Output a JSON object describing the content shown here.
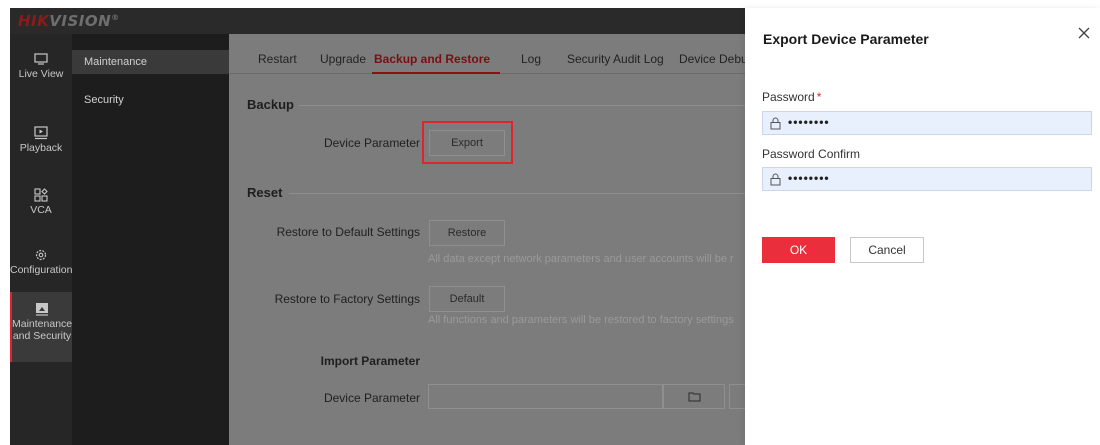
{
  "logo": {
    "brand": "HIK",
    "brand2": "VISION",
    "mark": "®"
  },
  "rail": {
    "items": [
      {
        "label": "Live View",
        "icon": "monitor-icon"
      },
      {
        "label": "Playback",
        "icon": "playback-icon"
      },
      {
        "label": "VCA",
        "icon": "vca-grid-icon"
      },
      {
        "label": "Configuration",
        "icon": "gear-icon"
      },
      {
        "label": "Maintenance and Security",
        "line1": "Maintenance",
        "line2": "and Security",
        "icon": "maintenance-icon",
        "active": true
      }
    ]
  },
  "submenu": {
    "items": [
      {
        "label": "Maintenance",
        "active": true
      },
      {
        "label": "Security"
      }
    ]
  },
  "tabs": {
    "items": [
      {
        "label": "Restart"
      },
      {
        "label": "Upgrade"
      },
      {
        "label": "Backup and Restore",
        "active": true
      },
      {
        "label": "Log"
      },
      {
        "label": "Security Audit Log"
      },
      {
        "label": "Device Debu"
      }
    ]
  },
  "backup": {
    "title": "Backup",
    "device_parameter_label": "Device Parameter",
    "export_label": "Export"
  },
  "reset": {
    "title": "Reset",
    "restore_default_label": "Restore to Default Settings",
    "restore_button": "Restore",
    "restore_hint": "All data except network parameters and user accounts will be r",
    "restore_factory_label": "Restore to Factory Settings",
    "default_button": "Default",
    "factory_hint": "All functions and parameters will be restored to factory settings"
  },
  "import": {
    "title": "Import Parameter",
    "device_parameter_label": "Device Parameter"
  },
  "panel": {
    "title": "Export Device Parameter",
    "password_label": "Password",
    "required_mark": "*",
    "password_value": "••••••••",
    "confirm_label": "Password Confirm",
    "confirm_value": "••••••••",
    "ok_label": "OK",
    "cancel_label": "Cancel"
  },
  "colors": {
    "accent_red": "#ea2e3b",
    "highlight_red": "#e0242f",
    "active_tab": "#7a0f12",
    "input_fill": "#e8f0fe"
  }
}
